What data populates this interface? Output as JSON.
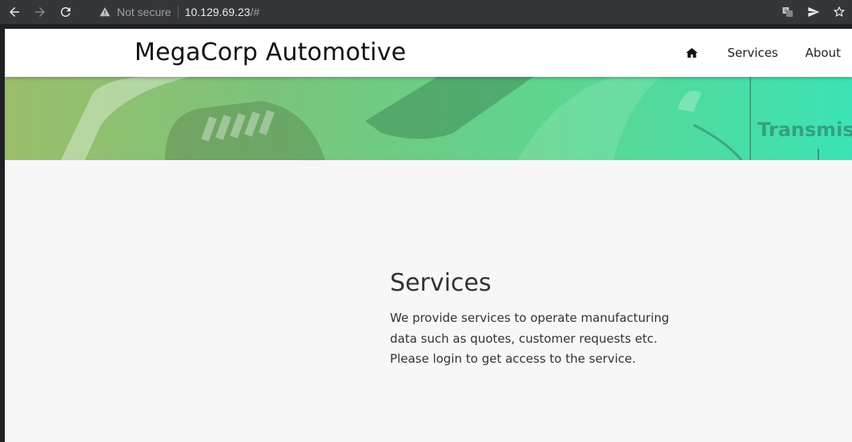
{
  "browser": {
    "security_label": "Not secure",
    "url_host": "10.129.69.23",
    "url_path": "/#",
    "icons": [
      "back-icon",
      "forward-icon",
      "reload-icon",
      "warning-icon",
      "translate-icon",
      "send-icon",
      "bookmark-star-icon"
    ]
  },
  "header": {
    "brand": "MegaCorp Automotive",
    "nav": {
      "home_icon": "home-icon",
      "services": "Services",
      "about": "About"
    }
  },
  "hero": {
    "partial_text": "Transmissi"
  },
  "main": {
    "title": "Services",
    "description": "We provide services to operate manufacturing data such as quotes, customer requests etc. Please login to get access to the service."
  },
  "colors": {
    "chrome_bg": "#35363a",
    "page_bg": "#f7f7f7",
    "hero_start": "#9bbe6a",
    "hero_end": "#3be3b4"
  }
}
